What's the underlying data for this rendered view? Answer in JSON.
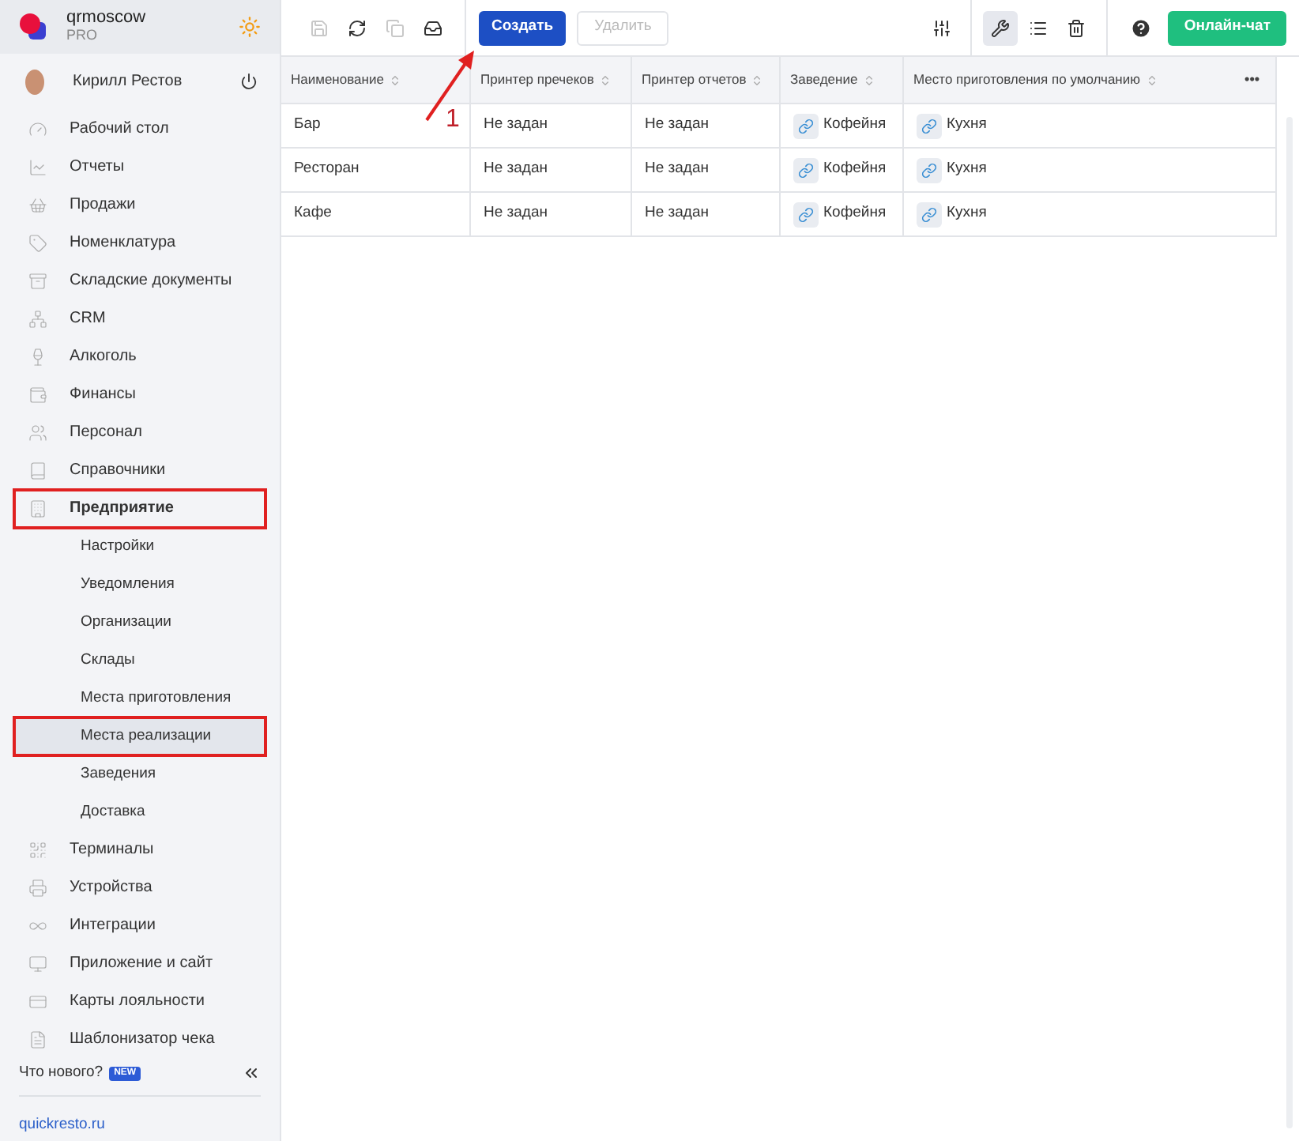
{
  "sidebar": {
    "account": {
      "name": "qrmoscow",
      "plan": "PRO"
    },
    "user": {
      "name": "Кирилл Рестов"
    },
    "items": [
      {
        "label": "Рабочий стол",
        "annotated": false
      },
      {
        "label": "Отчеты",
        "annotated": false
      },
      {
        "label": "Продажи",
        "annotated": false
      },
      {
        "label": "Номенклатура",
        "annotated": false
      },
      {
        "label": "Складские документы",
        "annotated": false
      },
      {
        "label": "CRM",
        "annotated": false
      },
      {
        "label": "Алкоголь",
        "annotated": false
      },
      {
        "label": "Финансы",
        "annotated": false
      },
      {
        "label": "Персонал",
        "annotated": false
      },
      {
        "label": "Справочники",
        "annotated": false
      },
      {
        "label": "Предприятие",
        "annotated": true,
        "expanded": true,
        "children": [
          {
            "label": "Настройки",
            "selected": false,
            "annotated": false
          },
          {
            "label": "Уведомления",
            "selected": false,
            "annotated": false
          },
          {
            "label": "Организации",
            "selected": false,
            "annotated": false
          },
          {
            "label": "Склады",
            "selected": false,
            "annotated": false
          },
          {
            "label": "Места приготовления",
            "selected": false,
            "annotated": false
          },
          {
            "label": "Места реализации",
            "selected": true,
            "annotated": true
          },
          {
            "label": "Заведения",
            "selected": false,
            "annotated": false
          },
          {
            "label": "Доставка",
            "selected": false,
            "annotated": false
          }
        ]
      },
      {
        "label": "Терминалы",
        "annotated": false
      },
      {
        "label": "Устройства",
        "annotated": false
      },
      {
        "label": "Интеграции",
        "annotated": false
      },
      {
        "label": "Приложение и сайт",
        "annotated": false
      },
      {
        "label": "Карты лояльности",
        "annotated": false
      },
      {
        "label": "Шаблонизатор чека",
        "annotated": false
      }
    ],
    "whats_new": "Что нового?",
    "new_badge": "NEW",
    "footer_link": "quickresto.ru"
  },
  "toolbar": {
    "left_icons": [
      {
        "disabled": true
      },
      {
        "disabled": false
      },
      {
        "disabled": true
      },
      {
        "disabled": false
      }
    ],
    "create_button": {
      "label": "Создать",
      "disabled": false
    },
    "delete_button": {
      "label": "Удалить",
      "disabled": true
    },
    "right_icons": [
      {
        "selected": false
      },
      {
        "selected": true
      },
      {
        "selected": false
      },
      {
        "selected": false
      }
    ],
    "chat_button": "Онлайн-чат"
  },
  "annotation": {
    "label": "1"
  },
  "table": {
    "columns": [
      "Наименование",
      "Принтер пречеков",
      "Принтер отчетов",
      "Заведение",
      "Место приготовления по умолчанию"
    ],
    "more": "•••",
    "rows": [
      [
        "Бар",
        "Не задан",
        "Не задан",
        "Кофейня",
        "Кухня"
      ],
      [
        "Ресторан",
        "Не задан",
        "Не задан",
        "Кофейня",
        "Кухня"
      ],
      [
        "Кафе",
        "Не задан",
        "Не задан",
        "Кофейня",
        "Кухня"
      ]
    ]
  }
}
